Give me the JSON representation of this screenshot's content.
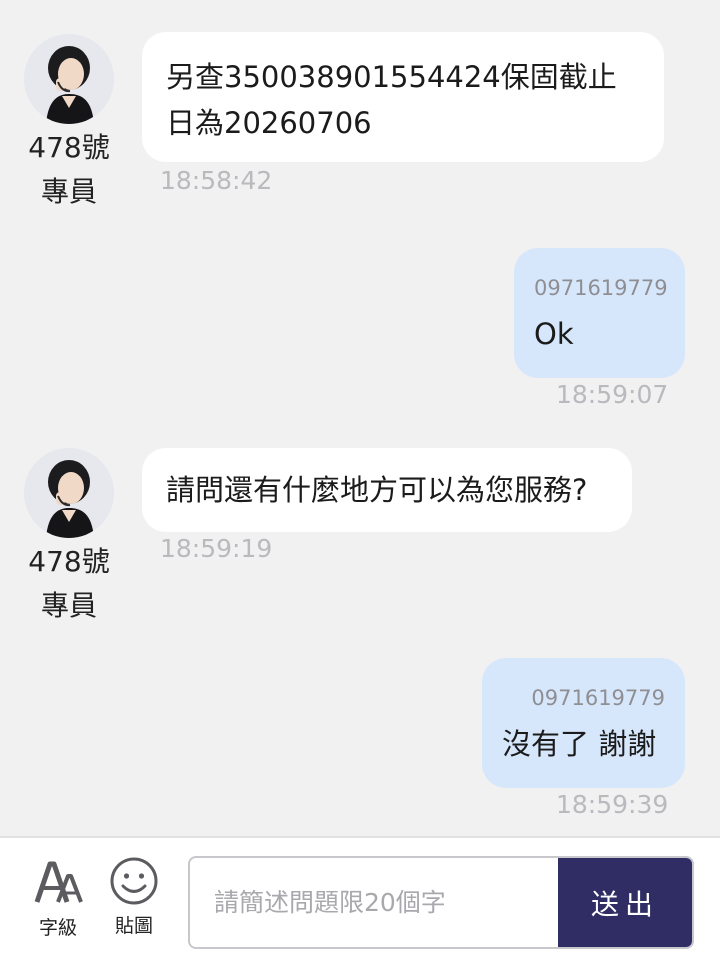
{
  "messages": [
    {
      "direction": "in",
      "agent": {
        "line1": "478號",
        "line2": "專員"
      },
      "text_line1": "另查350038901554424保固截止",
      "text_line2": "日為20260706",
      "time": "18:58:42"
    },
    {
      "direction": "out",
      "sender": "0971619779",
      "text": "Ok",
      "time": "18:59:07"
    },
    {
      "direction": "in",
      "agent": {
        "line1": "478號",
        "line2": "專員"
      },
      "text": "請問還有什麼地方可以為您服務?",
      "time": "18:59:19"
    },
    {
      "direction": "out",
      "sender": "0971619779",
      "text": "沒有了 謝謝",
      "time": "18:59:39"
    }
  ],
  "toolbar": {
    "font_size_label": "字級",
    "font_size_icon": "font-size-icon",
    "sticker_label": "貼圖",
    "sticker_icon": "smiley-icon",
    "input_placeholder": "請簡述問題限20個字",
    "input_value": "",
    "send_label": "送出"
  },
  "colors": {
    "background": "#f1f1f2",
    "incoming_bubble": "#ffffff",
    "outgoing_bubble": "#d7e7fb",
    "send_button": "#2f2d63",
    "timestamp": "#b9b9be"
  }
}
